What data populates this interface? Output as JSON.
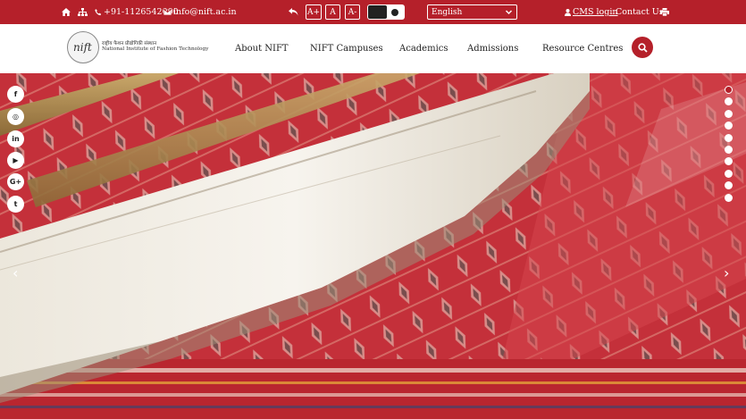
{
  "topbar": {
    "phone": "+91-1126542000",
    "email": "info@nift.ac.in",
    "font_increase": "A+",
    "font_normal": "A",
    "font_decrease": "A-",
    "language_selected": "English",
    "cms_login": "CMS login",
    "contact_us": "Contact Us"
  },
  "header": {
    "logo_mark": "nift",
    "logo_hindi": "राष्ट्रीय फैशन प्रौद्योगिकी संस्थान",
    "logo_english": "National Institute of Fashion Technology",
    "nav": [
      "About NIFT",
      "NIFT Campuses",
      "Academics",
      "Admissions",
      "Resource Centres"
    ]
  },
  "hero": {
    "social_icons": [
      "facebook-icon",
      "instagram-icon",
      "linkedin-icon",
      "youtube-icon",
      "google-plus-icon",
      "twitter-icon"
    ],
    "social_glyphs": [
      "f",
      "◎",
      "in",
      "▶",
      "G+",
      "t"
    ],
    "slides_total": 10,
    "slide_active": 1
  },
  "colors": {
    "brand_red": "#b5202a",
    "white": "#ffffff"
  }
}
